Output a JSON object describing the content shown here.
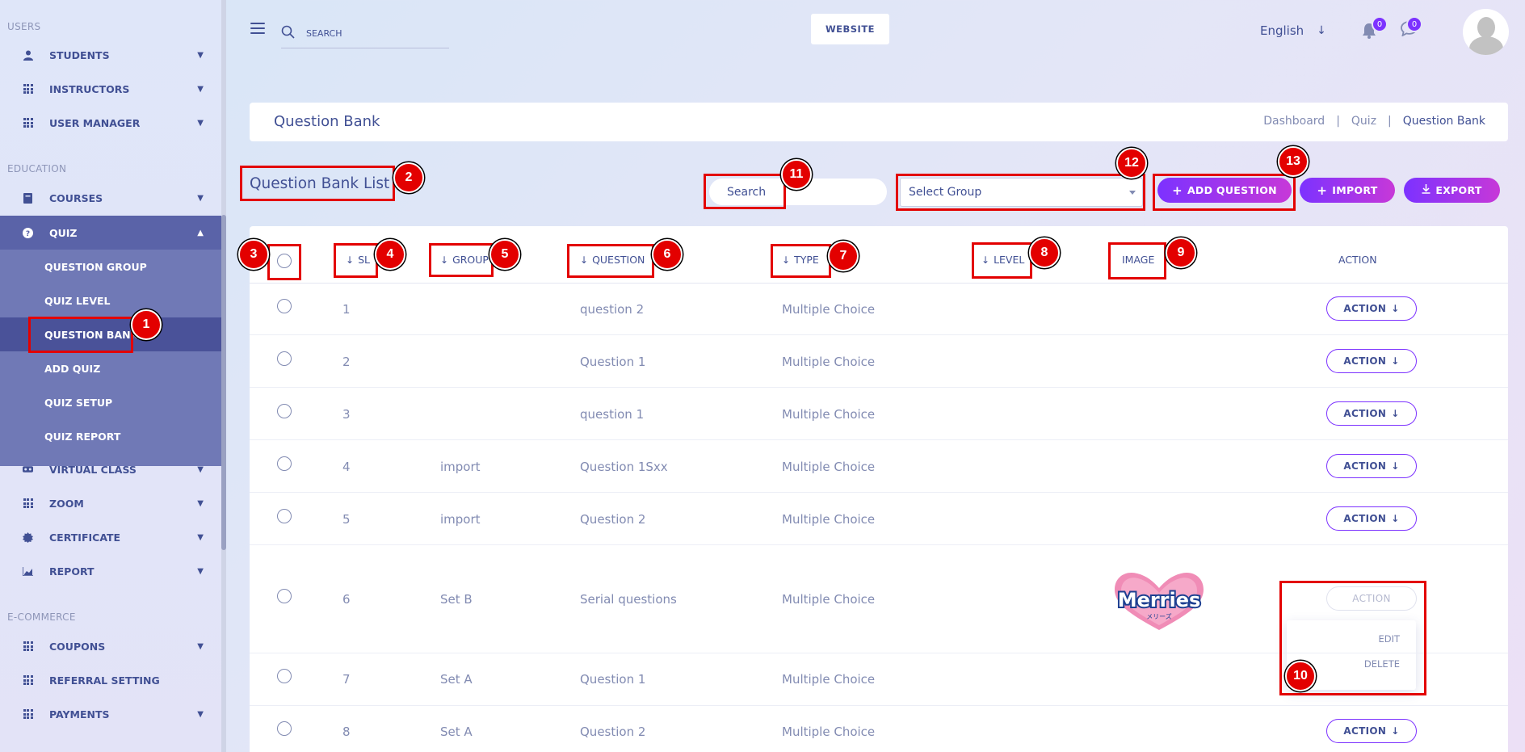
{
  "sidebar": {
    "sections": {
      "users": "USERS",
      "education": "EDUCATION",
      "ecommerce": "E-COMMERCE"
    },
    "items": {
      "students": "STUDENTS",
      "instructors": "INSTRUCTORS",
      "user_manager": "USER MANAGER",
      "courses": "COURSES",
      "quiz": "QUIZ",
      "virtual_class": "VIRTUAL CLASS",
      "zoom": "ZOOM",
      "certificate": "CERTIFICATE",
      "report": "REPORT",
      "coupons": "COUPONS",
      "referral_setting": "REFERRAL SETTING",
      "payments": "PAYMENTS"
    },
    "quiz_submenu": {
      "question_group": "QUESTION GROUP",
      "quiz_level": "QUIZ LEVEL",
      "question_bank": "QUESTION BANK",
      "add_quiz": "ADD QUIZ",
      "quiz_setup": "QUIZ SETUP",
      "quiz_report": "QUIZ REPORT"
    }
  },
  "topbar": {
    "search_placeholder": "SEARCH",
    "website_label": "WEBSITE",
    "language": "English",
    "notification_count": "0",
    "message_count": "0"
  },
  "header": {
    "title": "Question Bank",
    "breadcrumb": [
      "Dashboard",
      "Quiz",
      "Question Bank"
    ],
    "separator": "|"
  },
  "list": {
    "title": "Question Bank List",
    "search_placeholder": "Search",
    "select_group": "Select Group",
    "add_question": "ADD QUESTION",
    "import": "IMPORT",
    "export": "EXPORT"
  },
  "table": {
    "columns": {
      "sl": "SL",
      "group": "GROUP",
      "question": "QUESTION",
      "type": "TYPE",
      "level": "LEVEL",
      "image": "IMAGE",
      "action": "ACTION"
    },
    "action_label": "ACTION",
    "rows": [
      {
        "sl": "1",
        "group": "",
        "question": "question 2",
        "type": "Multiple Choice"
      },
      {
        "sl": "2",
        "group": "",
        "question": "Question 1",
        "type": "Multiple Choice"
      },
      {
        "sl": "3",
        "group": "",
        "question": "question 1",
        "type": "Multiple Choice"
      },
      {
        "sl": "4",
        "group": "import",
        "question": "Question 1Sxx",
        "type": "Multiple Choice"
      },
      {
        "sl": "5",
        "group": "import",
        "question": "Question 2",
        "type": "Multiple Choice"
      },
      {
        "sl": "6",
        "group": "Set B",
        "question": "Serial questions",
        "type": "Multiple Choice"
      },
      {
        "sl": "7",
        "group": "Set A",
        "question": "Question 1",
        "type": "Multiple Choice"
      },
      {
        "sl": "8",
        "group": "Set A",
        "question": "Question 2",
        "type": "Multiple Choice"
      }
    ],
    "dropdown": {
      "edit": "EDIT",
      "delete": "DELETE"
    },
    "image_logo_text": "Merries"
  },
  "annotations": [
    "1",
    "2",
    "3",
    "4",
    "5",
    "6",
    "7",
    "8",
    "9",
    "10",
    "11",
    "12",
    "13"
  ],
  "colors": {
    "primary": "#415094",
    "accent_start": "#7c32ff",
    "accent_end": "#c738d8",
    "annotation": "#e30000"
  }
}
